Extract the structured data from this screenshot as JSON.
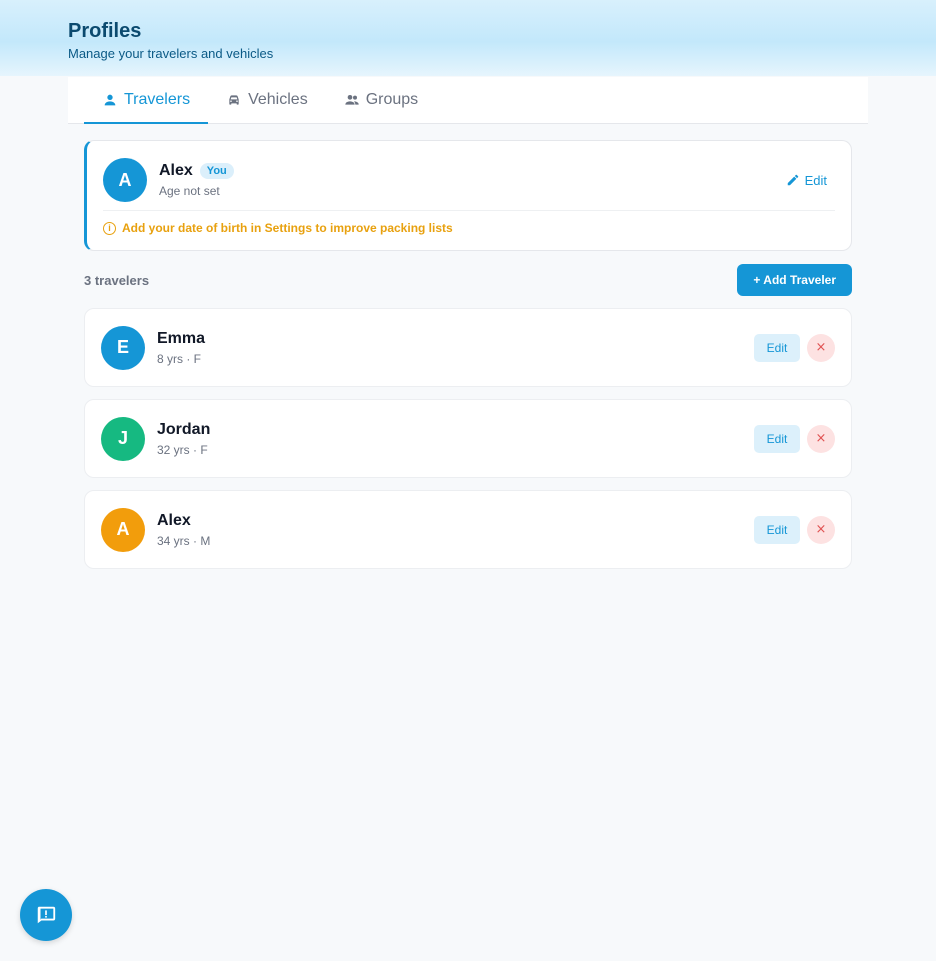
{
  "header": {
    "title": "Profiles",
    "subtitle": "Manage your travelers and vehicles"
  },
  "tabs": [
    {
      "label": "Travelers",
      "icon": "person-icon",
      "active": true
    },
    {
      "label": "Vehicles",
      "icon": "car-icon",
      "active": false
    },
    {
      "label": "Groups",
      "icon": "group-icon",
      "active": false
    }
  ],
  "me": {
    "initial": "A",
    "name": "Alex",
    "badge": "You",
    "age_text": "Age not set",
    "edit_label": "Edit",
    "warning": "Add your date of birth in Settings to improve packing lists",
    "avatar_color": "#1596d6"
  },
  "list": {
    "count_text": "3 travelers",
    "add_label": "+ Add Traveler",
    "edit_label": "Edit",
    "delete_label": "×",
    "travelers": [
      {
        "initial": "E",
        "name": "Emma",
        "meta": "8 yrs · F",
        "color": "#1596d6"
      },
      {
        "initial": "J",
        "name": "Jordan",
        "meta": "32 yrs · F",
        "color": "#16b981"
      },
      {
        "initial": "A",
        "name": "Alex",
        "meta": "34 yrs · M",
        "color": "#f29d0c"
      }
    ]
  },
  "fab": {
    "icon": "feedback-icon"
  },
  "colors": {
    "accent": "#1596d6",
    "warning": "#e8a10f",
    "danger": "#e05252"
  }
}
